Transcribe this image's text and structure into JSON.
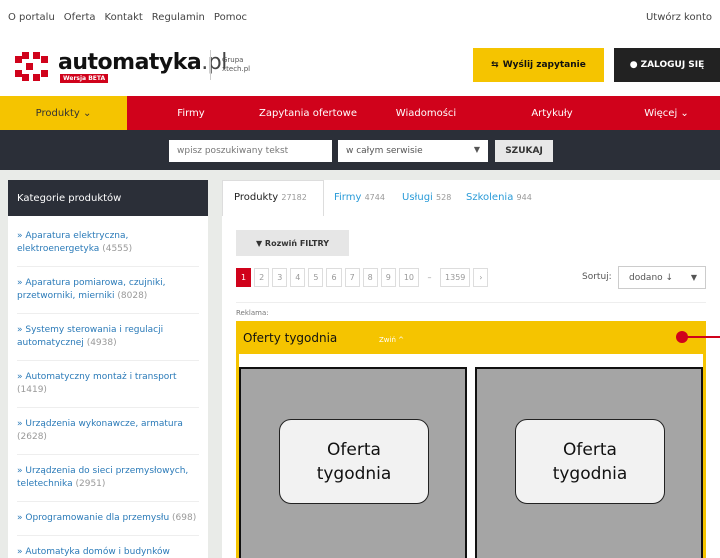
{
  "topbar": {
    "links": [
      "O portalu",
      "Oferta",
      "Kontakt",
      "Regulamin",
      "Pomoc"
    ],
    "create_account": "Utwórz konto"
  },
  "header": {
    "brand": "automatyka",
    "brand_suffix": ".pl",
    "beta": "Wersja BETA",
    "group_line1": "Grupa",
    "group_line2": "xtech.pl",
    "send_inquiry": "Wyślij zapytanie",
    "login": "ZALOGUJ SIĘ"
  },
  "nav": {
    "items": [
      {
        "label": "Produkty ⌄"
      },
      {
        "label": "Firmy"
      },
      {
        "label": "Zapytania ofertowe"
      },
      {
        "label": "Wiadomości"
      },
      {
        "label": "Artykuły"
      },
      {
        "label": "Więcej ⌄"
      }
    ]
  },
  "search": {
    "placeholder": "wpisz poszukiwany tekst",
    "scope": "w całym serwisie",
    "button": "SZUKAJ"
  },
  "sidebar": {
    "title": "Kategorie produktów",
    "categories": [
      {
        "label": "» Aparatura elektryczna, elektroenergetyka",
        "count": "(4555)"
      },
      {
        "label": "» Aparatura pomiarowa, czujniki, przetworniki, mierniki",
        "count": "(8028)"
      },
      {
        "label": "» Systemy sterowania i regulacji automatycznej",
        "count": "(4938)"
      },
      {
        "label": "» Automatyczny montaż i transport",
        "count": "(1419)"
      },
      {
        "label": "» Urządzenia wykonawcze, armatura",
        "count": "(2628)"
      },
      {
        "label": "» Urządzenia do sieci przemysłowych, teletechnika",
        "count": "(2951)"
      },
      {
        "label": "» Oprogramowanie dla przemysłu",
        "count": "(698)"
      },
      {
        "label": "» Automatyka domów i budynków",
        "count": ""
      }
    ]
  },
  "tabs": [
    {
      "label": "Produkty",
      "count": "27182"
    },
    {
      "label": "Firmy",
      "count": "4744"
    },
    {
      "label": "Usługi",
      "count": "528"
    },
    {
      "label": "Szkolenia",
      "count": "944"
    }
  ],
  "filters": {
    "label": "Rozwiń FILTRY"
  },
  "pager": [
    "1",
    "2",
    "3",
    "4",
    "5",
    "6",
    "7",
    "8",
    "9",
    "10",
    "–",
    "1359",
    "›"
  ],
  "sort": {
    "label": "Sortuj:",
    "value": "dodano ↓"
  },
  "ads": {
    "label": "Reklama:"
  },
  "offers": {
    "title": "Oferty tygodnia",
    "toggle": "Zwiń ^",
    "items": [
      "Oferta tygodnia",
      "Oferta tygodnia"
    ]
  },
  "colors": {
    "accent_red": "#d0021b",
    "accent_yellow": "#f5c400",
    "dark": "#2b2f38"
  }
}
